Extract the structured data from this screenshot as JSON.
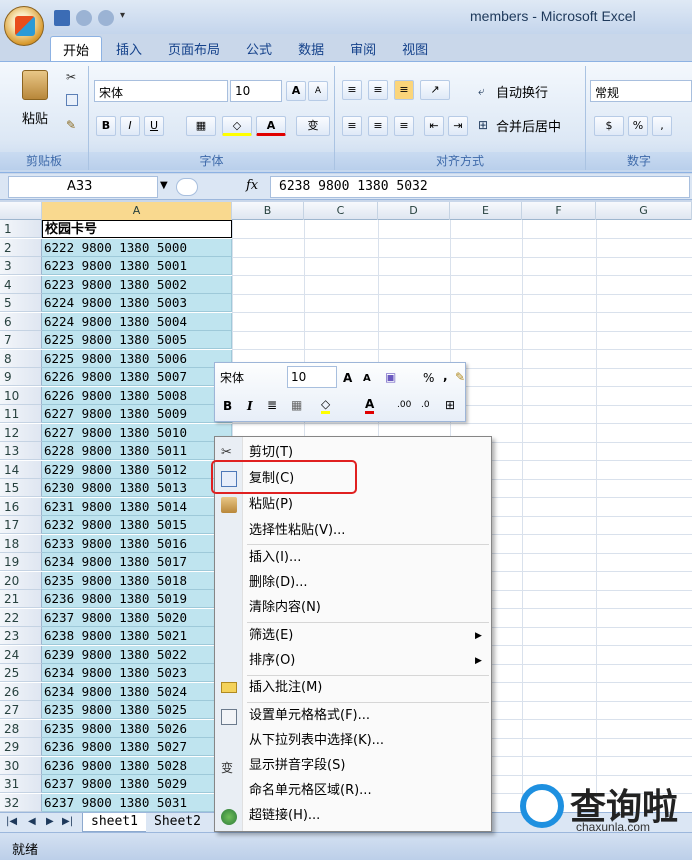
{
  "window": {
    "title": "members - Microsoft Excel"
  },
  "ribbon": {
    "tabs": [
      "开始",
      "插入",
      "页面布局",
      "公式",
      "数据",
      "审阅",
      "视图"
    ],
    "active_tab": "开始",
    "clipboard": {
      "paste_label": "粘贴",
      "group_label": "剪贴板"
    },
    "font": {
      "name": "宋体",
      "size": "10",
      "group_label": "字体",
      "bold": "B",
      "italic": "I",
      "underline": "U",
      "grow": "A",
      "shrink": "A",
      "color_a": "A",
      "wen": "变"
    },
    "alignment": {
      "wrap_label": "自动换行",
      "merge_label": "合并后居中",
      "group_label": "对齐方式"
    },
    "number": {
      "format": "常规",
      "group_label": "数字",
      "percent": "%",
      "comma": ","
    }
  },
  "formula_bar": {
    "name_box": "A33",
    "fx": "fx",
    "formula": "6238 9800 1380 5032"
  },
  "columns": [
    "A",
    "B",
    "C",
    "D",
    "E",
    "F",
    "G"
  ],
  "rows": [
    {
      "n": "1",
      "a": "校园卡号"
    },
    {
      "n": "2",
      "a": "6222 9800 1380 5000"
    },
    {
      "n": "3",
      "a": "6223 9800 1380 5001"
    },
    {
      "n": "4",
      "a": "6223 9800 1380 5002"
    },
    {
      "n": "5",
      "a": "6224 9800 1380 5003"
    },
    {
      "n": "6",
      "a": "6224 9800 1380 5004"
    },
    {
      "n": "7",
      "a": "6225 9800 1380 5005"
    },
    {
      "n": "8",
      "a": "6225 9800 1380 5006"
    },
    {
      "n": "9",
      "a": "6226 9800 1380 5007"
    },
    {
      "n": "10",
      "a": "6226 9800 1380 5008"
    },
    {
      "n": "11",
      "a": "6227 9800 1380 5009"
    },
    {
      "n": "12",
      "a": "6227 9800 1380 5010"
    },
    {
      "n": "13",
      "a": "6228 9800 1380 5011"
    },
    {
      "n": "14",
      "a": "6229 9800 1380 5012"
    },
    {
      "n": "15",
      "a": "6230 9800 1380 5013"
    },
    {
      "n": "16",
      "a": "6231 9800 1380 5014"
    },
    {
      "n": "17",
      "a": "6232 9800 1380 5015"
    },
    {
      "n": "18",
      "a": "6233 9800 1380 5016"
    },
    {
      "n": "19",
      "a": "6234 9800 1380 5017"
    },
    {
      "n": "20",
      "a": "6235 9800 1380 5018"
    },
    {
      "n": "21",
      "a": "6236 9800 1380 5019"
    },
    {
      "n": "22",
      "a": "6237 9800 1380 5020"
    },
    {
      "n": "23",
      "a": "6238 9800 1380 5021"
    },
    {
      "n": "24",
      "a": "6239 9800 1380 5022"
    },
    {
      "n": "25",
      "a": "6234 9800 1380 5023"
    },
    {
      "n": "26",
      "a": "6234 9800 1380 5024"
    },
    {
      "n": "27",
      "a": "6235 9800 1380 5025"
    },
    {
      "n": "28",
      "a": "6235 9800 1380 5026"
    },
    {
      "n": "29",
      "a": "6236 9800 1380 5027"
    },
    {
      "n": "30",
      "a": "6236 9800 1380 5028"
    },
    {
      "n": "31",
      "a": "6237 9800 1380 5029"
    },
    {
      "n": "32",
      "a": "6237 9800 1380 5031"
    }
  ],
  "mini_toolbar": {
    "font": "宋体",
    "size": "10",
    "bold": "B",
    "italic": "I",
    "percent": "%",
    "comma": ","
  },
  "context_menu": {
    "items": [
      {
        "label": "剪切(T)",
        "icon": "scissors-icon"
      },
      {
        "label": "复制(C)",
        "icon": "copy-icon"
      },
      {
        "label": "粘贴(P)",
        "icon": "paste-icon"
      },
      {
        "label": "选择性粘贴(V)...",
        "icon": ""
      },
      {
        "label": "插入(I)...",
        "icon": ""
      },
      {
        "label": "删除(D)...",
        "icon": ""
      },
      {
        "label": "清除内容(N)",
        "icon": ""
      },
      {
        "label": "筛选(E)",
        "icon": "",
        "submenu": true
      },
      {
        "label": "排序(O)",
        "icon": "",
        "submenu": true
      },
      {
        "label": "插入批注(M)",
        "icon": "comment-icon"
      },
      {
        "label": "设置单元格格式(F)...",
        "icon": "format-cells-icon"
      },
      {
        "label": "从下拉列表中选择(K)...",
        "icon": ""
      },
      {
        "label": "显示拼音字段(S)",
        "icon": "phonetic-icon"
      },
      {
        "label": "命名单元格区域(R)...",
        "icon": ""
      },
      {
        "label": "超链接(H)...",
        "icon": "hyperlink-icon"
      }
    ],
    "highlighted": "复制(C)"
  },
  "sheets": {
    "tabs": [
      "sheet1",
      "Sheet2"
    ],
    "active": "sheet1"
  },
  "status": {
    "text": "就绪"
  },
  "watermark": {
    "text": "查询啦",
    "sub": "chaxunla.com"
  }
}
